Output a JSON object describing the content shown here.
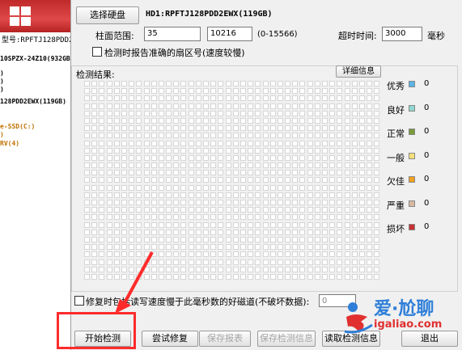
{
  "sidebar": {
    "tree_lines": [
      "型号:RPFTJ128PDD2",
      "10SPZX-24Z10(932GB",
      ")",
      ")",
      ")",
      "128PDD2EWX(119GB)",
      "e-SSD(C:)",
      ")",
      "RV(4)"
    ]
  },
  "toolbar": {
    "select_disk": "选择硬盘",
    "disk_label": "HD1:RPFTJ128PDD2EWX(119GB)"
  },
  "range": {
    "label": "柱面范围:",
    "start": "35",
    "arrow": "-->",
    "end": "10216",
    "hint": "(0-15566)"
  },
  "timeout": {
    "label": "超时时间:",
    "value": "3000",
    "unit": "毫秒"
  },
  "options": {
    "report_exact_sector": "检测时报告准确的扇区号(速度较慢)",
    "repair_option": "修复时包括读写速度慢于此毫秒数的好磁道(不破坏数据):",
    "repair_ms": "0"
  },
  "results": {
    "label": "检测结果:",
    "details_button": "详细信息",
    "grid_rows": 27,
    "grid_cols": 40
  },
  "legend": [
    {
      "name": "优秀",
      "color": "#5ab4e6",
      "count": "0"
    },
    {
      "name": "良好",
      "color": "#8fd8d0",
      "count": "0"
    },
    {
      "name": "正常",
      "color": "#7a9a3a",
      "count": "0"
    },
    {
      "name": "一般",
      "color": "#f4e07a",
      "count": "0"
    },
    {
      "name": "欠佳",
      "color": "#f0a020",
      "count": "0"
    },
    {
      "name": "严重",
      "color": "#d8b8a0",
      "count": "0"
    },
    {
      "name": "损坏",
      "color": "#c83030",
      "count": "0"
    }
  ],
  "buttons": {
    "start": "开始检测",
    "try_repair": "尝试修复",
    "save_report": "保存报表",
    "save_info": "保存检测信息",
    "read_info": "读取检测信息",
    "exit": "退出"
  },
  "watermark": {
    "cn": "爱·尬聊",
    "url": "igaliao.com"
  },
  "colors": {
    "annotation_red": "#ff2b2b",
    "watermark_blue": "#2f7fd8",
    "watermark_red": "#e03030"
  }
}
